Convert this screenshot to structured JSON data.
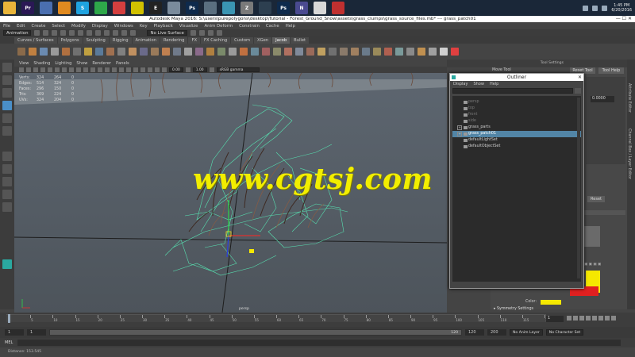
{
  "taskbar": {
    "apps": [
      {
        "name": "explorer",
        "color": "#e8b53a",
        "glyph": ""
      },
      {
        "name": "premiere",
        "color": "#2a1855",
        "glyph": "Pr"
      },
      {
        "name": "app3",
        "color": "#4a6fb0",
        "glyph": ""
      },
      {
        "name": "app4",
        "color": "#e08a20",
        "glyph": ""
      },
      {
        "name": "skype",
        "color": "#1fa3e0",
        "glyph": "S"
      },
      {
        "name": "app6",
        "color": "#2ea84a",
        "glyph": ""
      },
      {
        "name": "app7",
        "color": "#d43f3f",
        "glyph": ""
      },
      {
        "name": "app8",
        "color": "#d0c000",
        "glyph": ""
      },
      {
        "name": "epic",
        "color": "#222222",
        "glyph": "E"
      },
      {
        "name": "app10",
        "color": "#7a8b9c",
        "glyph": ""
      },
      {
        "name": "photoshop",
        "color": "#0e2a4c",
        "glyph": "Ps"
      },
      {
        "name": "app12",
        "color": "#5a6f80",
        "glyph": ""
      },
      {
        "name": "maya",
        "color": "#3a95b3",
        "glyph": ""
      },
      {
        "name": "app14",
        "color": "#7a7a7a",
        "glyph": "Z"
      },
      {
        "name": "app15",
        "color": "#2d3f50",
        "glyph": ""
      },
      {
        "name": "photoshop2",
        "color": "#0e2a4c",
        "glyph": "Ps"
      },
      {
        "name": "app17",
        "color": "#4a4a90",
        "glyph": "N"
      },
      {
        "name": "chrome",
        "color": "#d8d8d8",
        "glyph": ""
      },
      {
        "name": "app19",
        "color": "#c03030",
        "glyph": ""
      }
    ],
    "time": "1:45 PM",
    "date": "6/20/2016"
  },
  "window": {
    "title": "Autodesk Maya 2016: S:\\users\\purepolygons\\desktop\\Tutorial - Forest_Ground_Snow\\assets\\grass_clumps\\grass_source_files.mb*   ---   grass_patch01",
    "controls": "—  ☐  ✕"
  },
  "menubar": [
    "File",
    "Edit",
    "Create",
    "Select",
    "Modify",
    "Display",
    "Windows",
    "Key",
    "Playback",
    "Visualize",
    "Anim Deform",
    "Constrain",
    "Cache",
    "Help"
  ],
  "statusline": {
    "mode": "Animation",
    "surface": "No Live Surface"
  },
  "shelf_tabs": [
    "Curves / Surfaces",
    "Polygons",
    "Sculpting",
    "Rigging",
    "Animation",
    "Rendering",
    "FX",
    "FX Caching",
    "Custom",
    "XGen",
    "Jacob",
    "Bullet"
  ],
  "shelf_active": "Jacob",
  "viewport_menu": [
    "View",
    "Shading",
    "Lighting",
    "Show",
    "Renderer",
    "Panels"
  ],
  "viewport_toolbar": {
    "field1": "0.00",
    "field2": "1.00",
    "color_space": "sRGB gamma"
  },
  "hud": [
    {
      "label": "Verts:",
      "a": "324",
      "b": "264",
      "c": "0"
    },
    {
      "label": "Edges:",
      "a": "514",
      "b": "324",
      "c": "0"
    },
    {
      "label": "Faces:",
      "a": "296",
      "b": "150",
      "c": "0"
    },
    {
      "label": "Tris:",
      "a": "369",
      "b": "224",
      "c": "0"
    },
    {
      "label": "UVs:",
      "a": "324",
      "b": "204",
      "c": "0"
    }
  ],
  "camera_label": "persp",
  "watermark": "www.cgtsj.com",
  "outliner": {
    "title": "Outliner",
    "menu": [
      "Display",
      "Show",
      "Help"
    ],
    "items": [
      {
        "label": "persp",
        "state": "dim",
        "expand": ""
      },
      {
        "label": "top",
        "state": "dim",
        "expand": ""
      },
      {
        "label": "front",
        "state": "dim",
        "expand": ""
      },
      {
        "label": "side",
        "state": "dim",
        "expand": ""
      },
      {
        "label": "grass_parts",
        "state": "normal",
        "expand": "+"
      },
      {
        "label": "grass_patch01",
        "state": "selected",
        "expand": "+"
      },
      {
        "label": "defaultLightSet",
        "state": "normal",
        "expand": ""
      },
      {
        "label": "defaultObjectSet",
        "state": "normal",
        "expand": ""
      }
    ]
  },
  "tool_settings": {
    "header": "Tool Settings",
    "tool_name": "Move Tool",
    "reset_tool": "Reset Tool",
    "tool_help": "Tool Help",
    "value_field": "0.0000",
    "reset_btn": "Reset",
    "color_label": "Color:",
    "color_value": "#f5e800",
    "symmetry": "Symmetry Settings"
  },
  "side_tabs": [
    "Attribute Editor",
    "Channel Box / Layer Editor"
  ],
  "timeline": {
    "ticks": [
      "1",
      "5",
      "10",
      "15",
      "20",
      "25",
      "30",
      "35",
      "40",
      "45",
      "50",
      "55",
      "60",
      "65",
      "70",
      "75",
      "80",
      "85",
      "90",
      "95",
      "100",
      "105",
      "110",
      "115",
      "120"
    ],
    "current_frame": "1",
    "range_start": "1",
    "range_start2": "1",
    "range_mid": "120",
    "range_end": "120",
    "range_end2": "200",
    "anim_layer": "No Anim Layer",
    "character_set": "No Character Set"
  },
  "cmdline": {
    "label": "MEL"
  },
  "helpline": "Distance: 153.545"
}
